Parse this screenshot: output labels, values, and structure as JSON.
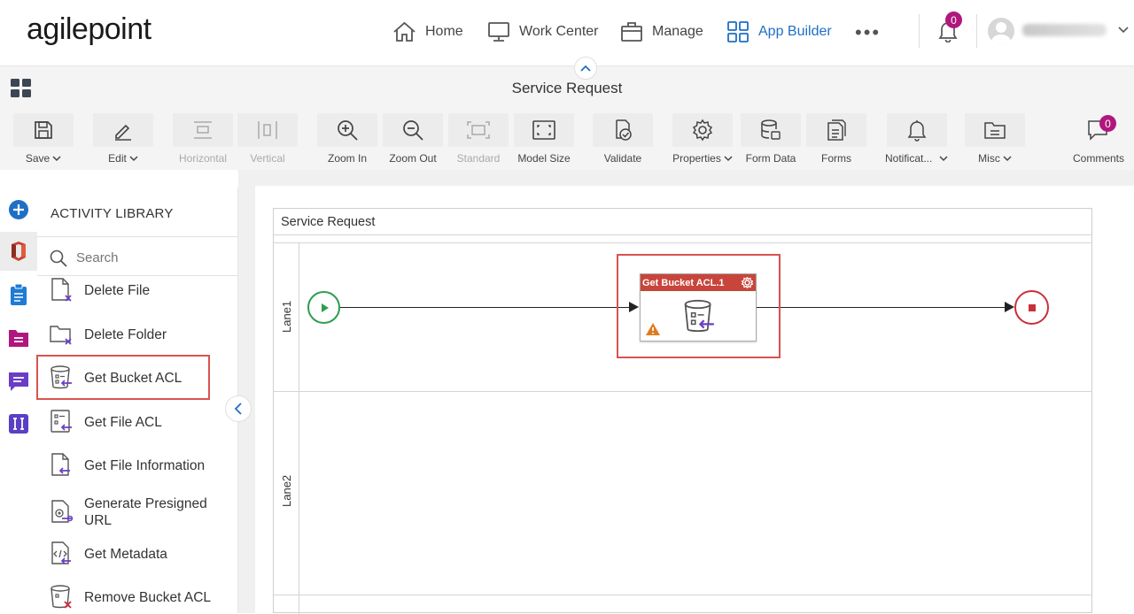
{
  "brand": {
    "logo_text": "agilepoint"
  },
  "nav": {
    "items": [
      {
        "label": "Home",
        "icon": "home-icon"
      },
      {
        "label": "Work Center",
        "icon": "monitor-icon"
      },
      {
        "label": "Manage",
        "icon": "briefcase-icon"
      },
      {
        "label": "App Builder",
        "icon": "grid-icon",
        "active": true
      }
    ],
    "more": "•••",
    "notifications_count": "0"
  },
  "titlebar": {
    "title": "Service Request"
  },
  "toolbar": {
    "save": "Save",
    "edit": "Edit",
    "horizontal": "Horizontal",
    "vertical": "Vertical",
    "zoom_in": "Zoom In",
    "zoom_out": "Zoom Out",
    "standard": "Standard",
    "model_size": "Model Size",
    "validate": "Validate",
    "properties": "Properties",
    "form_data": "Form Data",
    "forms": "Forms",
    "notifications": "Notificat...",
    "misc": "Misc",
    "comments": "Comments",
    "comments_count": "0"
  },
  "library": {
    "title": "ACTIVITY LIBRARY",
    "search_placeholder": "Search",
    "items": [
      {
        "label": "Delete File"
      },
      {
        "label": "Delete Folder"
      },
      {
        "label": "Get Bucket ACL"
      },
      {
        "label": "Get File ACL"
      },
      {
        "label": "Get File Information"
      },
      {
        "label": "Generate Presigned URL"
      },
      {
        "label": "Get Metadata"
      },
      {
        "label": "Remove Bucket ACL"
      }
    ]
  },
  "canvas": {
    "pool_title": "Service Request",
    "lanes": [
      "Lane1",
      "Lane2"
    ],
    "activity_title": "Get Bucket ACL.1"
  },
  "colors": {
    "accent": "#1f6fc5",
    "badge": "#b0177e",
    "start": "#2e9d4f",
    "end": "#c9303a",
    "activity_header": "#c8453c",
    "highlight": "#d9534f"
  }
}
